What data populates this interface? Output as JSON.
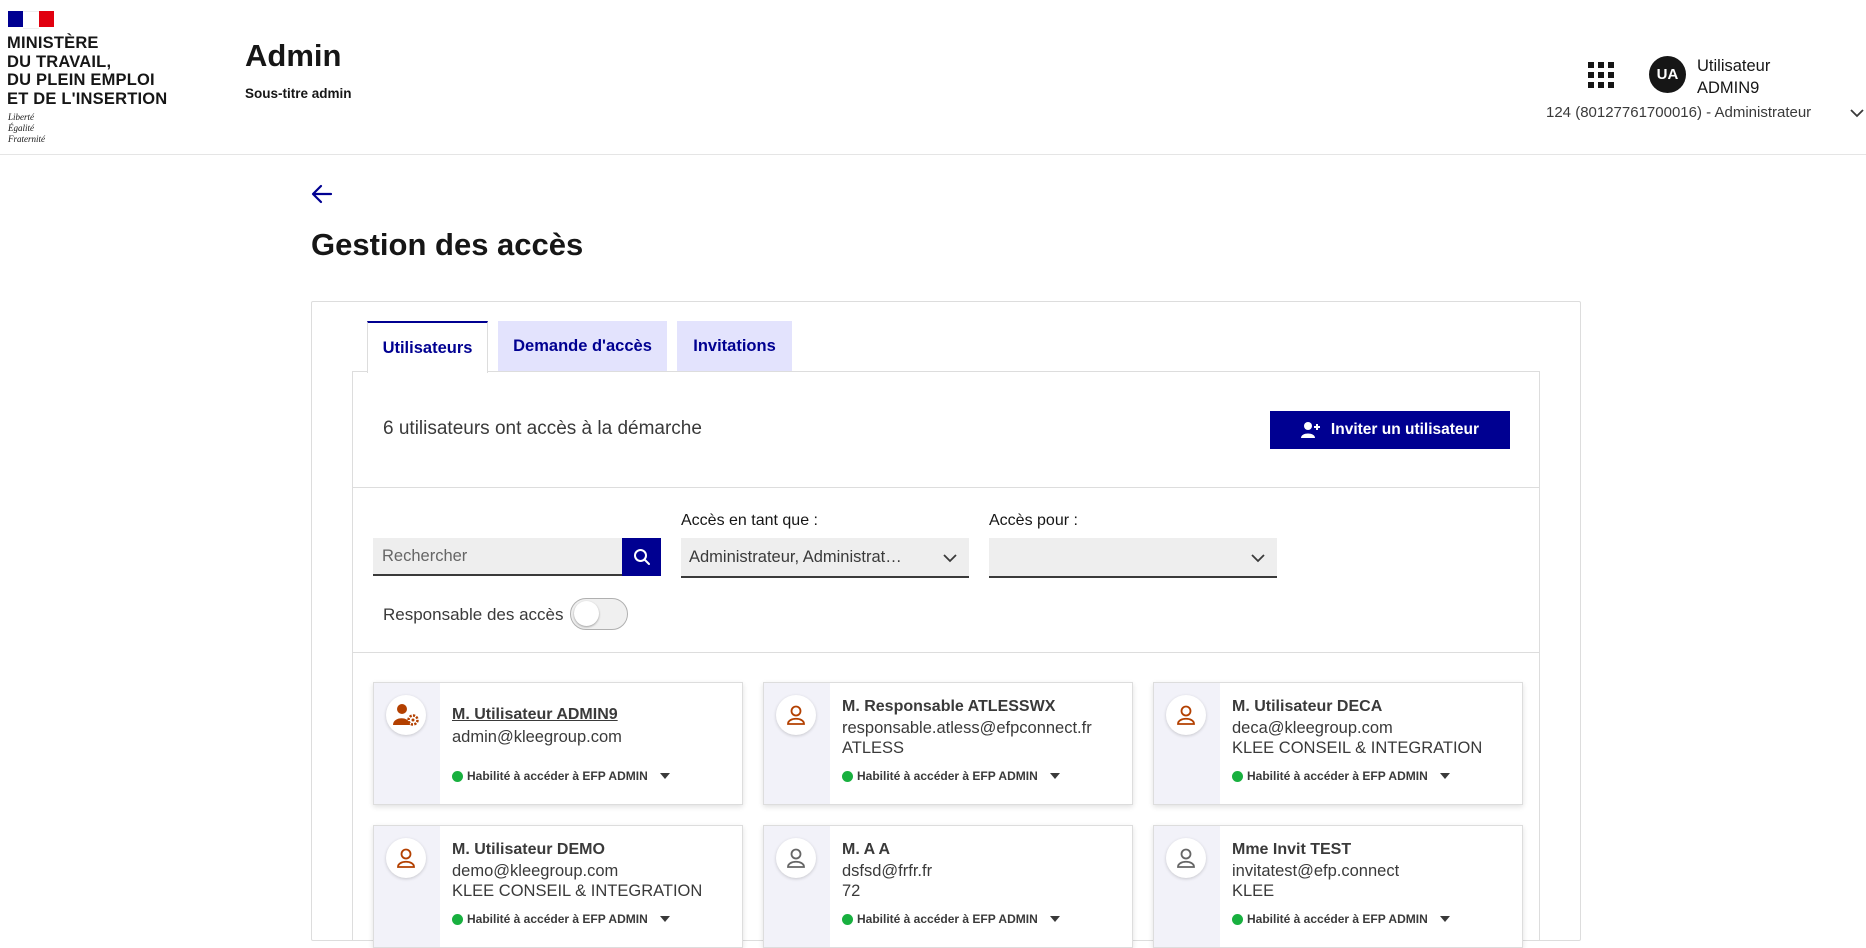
{
  "header": {
    "ministry_lines": [
      "MINISTÈRE",
      "DU TRAVAIL,",
      "DU PLEIN EMPLOI",
      "ET DE L'INSERTION"
    ],
    "motto_lines": [
      "Liberté",
      "Égalité",
      "Fraternité"
    ],
    "app_title": "Admin",
    "app_subtitle": "Sous-titre admin",
    "apps_icon": "grid-icon",
    "avatar_initials": "UA",
    "user_name_line1": "Utilisateur",
    "user_name_line2": "ADMIN9",
    "organization": "124 (80127761700016) - Administrateur",
    "flag_colors": [
      "#000091",
      "#ffffff",
      "#e1000f"
    ]
  },
  "page": {
    "back_icon": "arrow-left-icon",
    "title": "Gestion des accès"
  },
  "tabs": [
    {
      "label": "Utilisateurs",
      "active": true
    },
    {
      "label": "Demande d'accès",
      "active": false
    },
    {
      "label": "Invitations",
      "active": false
    }
  ],
  "panel": {
    "count_text": "6 utilisateurs ont accès à la démarche",
    "invite_button": "Inviter un utilisateur",
    "search_placeholder": "Rechercher",
    "access_as_label": "Accès en tant que :",
    "access_as_value": "Administrateur, Administrateur",
    "access_for_label": "Accès pour :",
    "access_for_value": "",
    "toggle_label": "Responsable des accès",
    "toggle_on": false
  },
  "users": [
    {
      "name": "M. Utilisateur ADMIN9",
      "email": "admin@kleegroup.com",
      "org": "",
      "badge": "Habilité à accéder à EFP ADMIN",
      "icon": "user-gear-icon"
    },
    {
      "name": "M. Responsable ATLESSWX",
      "email": "responsable.atless@efpconnect.fr",
      "org": "ATLESS",
      "badge": "Habilité à accéder à EFP ADMIN",
      "icon": "user-icon"
    },
    {
      "name": "M. Utilisateur DECA",
      "email": "deca@kleegroup.com",
      "org": "KLEE CONSEIL & INTEGRATION",
      "badge": "Habilité à accéder à EFP ADMIN",
      "icon": "user-icon"
    },
    {
      "name": "M. Utilisateur DEMO",
      "email": "demo@kleegroup.com",
      "org": "KLEE CONSEIL & INTEGRATION",
      "badge": "Habilité à accéder à EFP ADMIN",
      "icon": "user-icon"
    },
    {
      "name": "M. A A",
      "email": "dsfsd@frfr.fr",
      "org": "72",
      "badge": "Habilité à accéder à EFP ADMIN",
      "icon": "user-icon"
    },
    {
      "name": "Mme Invit TEST",
      "email": "invitatest@efp.connect",
      "org": "KLEE",
      "badge": "Habilité à accéder à EFP ADMIN",
      "icon": "user-icon"
    }
  ],
  "colors": {
    "primary": "#000091",
    "tab_inactive_bg": "#e3e3fd",
    "active_user_icon": "#b34000",
    "inactive_user_icon": "#666666",
    "status_dot": "#18b03f"
  }
}
